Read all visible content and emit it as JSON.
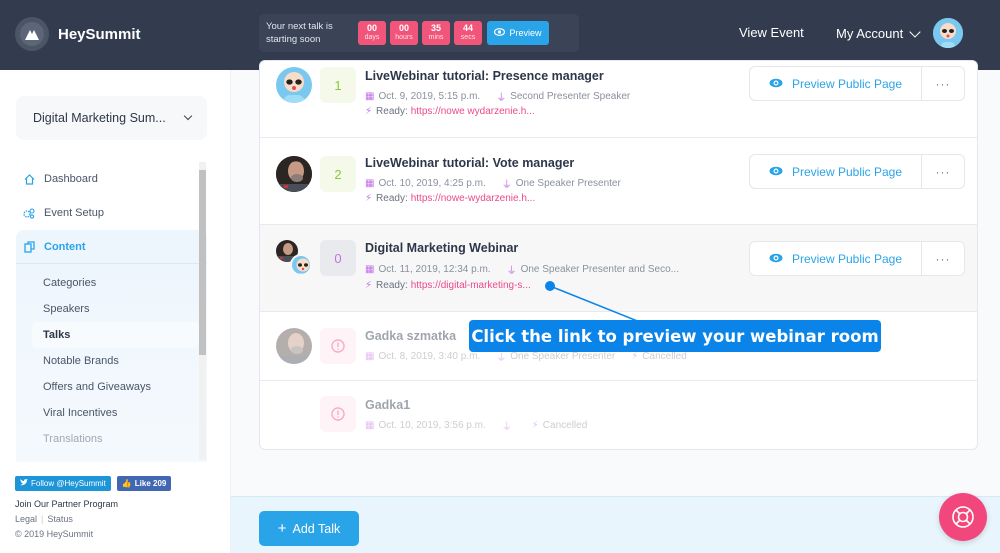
{
  "header": {
    "brand": "HeySummit",
    "countdown": {
      "label": "Your next talk is starting soon",
      "units": [
        {
          "value": "00",
          "unit": "days"
        },
        {
          "value": "00",
          "unit": "hours"
        },
        {
          "value": "35",
          "unit": "mins"
        },
        {
          "value": "44",
          "unit": "secs"
        }
      ],
      "preview_label": "Preview"
    },
    "view_event": "View Event",
    "my_account": "My Account"
  },
  "sidebar": {
    "event_name": "Digital Marketing Sum...",
    "nav": [
      {
        "label": "Dashboard",
        "icon": "home-icon"
      },
      {
        "label": "Event Setup",
        "icon": "gears-icon"
      },
      {
        "label": "Content",
        "icon": "copy-icon"
      }
    ],
    "content_items": [
      {
        "label": "Categories"
      },
      {
        "label": "Speakers"
      },
      {
        "label": "Talks"
      },
      {
        "label": "Notable Brands"
      },
      {
        "label": "Offers and Giveaways"
      },
      {
        "label": "Viral Incentives"
      },
      {
        "label": "Translations"
      }
    ],
    "footer": {
      "twitter": "Follow @HeySummit",
      "facebook": "Like 209",
      "partner": "Join Our Partner Program",
      "legal": "Legal",
      "status": "Status",
      "copyright": "© 2019 HeySummit"
    }
  },
  "talks": [
    {
      "number": "1",
      "title": "LiveWebinar tutorial: Presence manager",
      "date": "Oct. 9, 2019, 5:15 p.m.",
      "speakers": "Second Presenter Speaker",
      "status_label": "Ready:",
      "link": "https://nowe wydarzenie.h...",
      "preview": "Preview Public Page",
      "more": "···"
    },
    {
      "number": "2",
      "title": "LiveWebinar tutorial: Vote manager",
      "date": "Oct. 10, 2019, 4:25 p.m.",
      "speakers": "One Speaker Presenter",
      "status_label": "Ready:",
      "link": "https://nowe-wydarzenie.h...",
      "preview": "Preview Public Page",
      "more": "···"
    },
    {
      "number": "0",
      "title": "Digital Marketing Webinar",
      "date": "Oct. 11, 2019, 12:34 p.m.",
      "speakers": "One Speaker Presenter and Seco...",
      "status_label": "Ready:",
      "link": "https://digital-marketing-s...",
      "preview": "Preview Public Page",
      "more": "···"
    },
    {
      "number": "!",
      "title": "Gadka szmatka",
      "date": "Oct. 8, 2019, 3:40 p.m.",
      "speakers": "One Speaker Presenter",
      "status": "Cancelled"
    },
    {
      "number": "!",
      "title": "Gadka1",
      "date": "Oct. 10, 2019, 3:56 p.m.",
      "speakers": "",
      "status": "Cancelled"
    }
  ],
  "add_talk": "Add Talk",
  "annotation": "Click the link to preview your webinar room",
  "colors": {
    "topbar": "#333c4e",
    "accent": "#2aa4e8",
    "countdown": "#f2557a",
    "link": "#ec4a8a",
    "icon_purple": "#c471e8",
    "help": "#f2477d",
    "annotation": "#0a84e9"
  }
}
